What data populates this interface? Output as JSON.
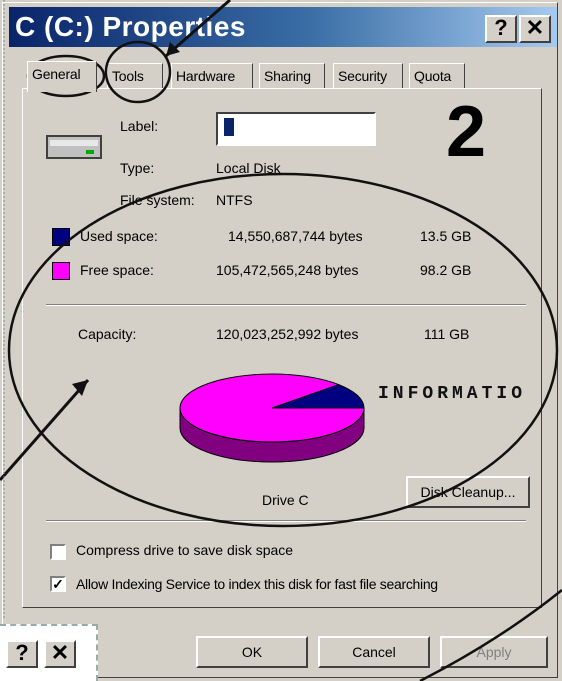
{
  "window": {
    "title": "C (C:) Properties",
    "help_btn": "?",
    "close_btn": "✕"
  },
  "tabs": [
    "General",
    "Tools",
    "Hardware",
    "Sharing",
    "Security",
    "Quota"
  ],
  "general": {
    "label_caption": "Label:",
    "label_value": "",
    "type_caption": "Type:",
    "type_value": "Local Disk",
    "fs_caption": "File system:",
    "fs_value": "NTFS",
    "used": {
      "label": "Used space:",
      "bytes": "14,550,687,744 bytes",
      "size": "13.5 GB",
      "color": "#000080"
    },
    "free": {
      "label": "Free space:",
      "bytes": "105,472,565,248 bytes",
      "size": "98.2 GB",
      "color": "#ff00ff"
    },
    "capacity": {
      "label": "Capacity:",
      "bytes": "120,023,252,992 bytes",
      "size": "111 GB"
    },
    "drive_label": "Drive C",
    "disk_cleanup": "Disk Cleanup...",
    "compress_label": "Compress drive to save disk space",
    "compress_checked": false,
    "index_label": "Allow Indexing Service to index this disk for fast file searching",
    "index_checked": true
  },
  "buttons": {
    "ok": "OK",
    "cancel": "Cancel",
    "apply": "Apply"
  },
  "annotations": {
    "number": "2",
    "info_text": "INFORMATIO"
  },
  "mini_titlebar": {
    "help_btn": "?",
    "close_btn": "✕"
  },
  "chart_data": {
    "type": "pie",
    "categories": [
      "Used space",
      "Free space"
    ],
    "values": [
      14550687744,
      105472565248
    ],
    "colors": [
      "#000080",
      "#ff00ff"
    ]
  }
}
